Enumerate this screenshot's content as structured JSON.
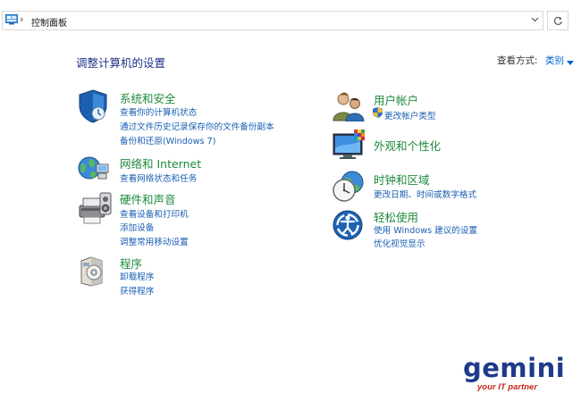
{
  "address_bar": {
    "separator": "›",
    "path": "控制面板"
  },
  "header": {
    "title": "调整计算机的设置",
    "view_by_label": "查看方式:",
    "view_by_value": "类别"
  },
  "categories": [
    {
      "title": "系统和安全",
      "icon": "system-security-icon",
      "links": [
        "查看你的计算机状态",
        "通过文件历史记录保存你的文件备份副本",
        "备份和还原(Windows 7)"
      ]
    },
    {
      "title": "网络和 Internet",
      "icon": "network-internet-icon",
      "links": [
        "查看网络状态和任务"
      ]
    },
    {
      "title": "硬件和声音",
      "icon": "hardware-sound-icon",
      "links": [
        "查看设备和打印机",
        "添加设备",
        "调整常用移动设置"
      ]
    },
    {
      "title": "程序",
      "icon": "programs-icon",
      "links": [
        "卸载程序",
        "获得程序"
      ]
    },
    {
      "title": "用户帐户",
      "icon": "user-accounts-icon",
      "links": [
        "更改帐户类型"
      ]
    },
    {
      "title": "外观和个性化",
      "icon": "appearance-personalization-icon",
      "links": []
    },
    {
      "title": "时钟和区域",
      "icon": "clock-region-icon",
      "links": [
        "更改日期、时间或数字格式"
      ]
    },
    {
      "title": "轻松使用",
      "icon": "ease-of-access-icon",
      "links": [
        "使用 Windows 建议的设置",
        "优化视觉显示"
      ]
    }
  ],
  "watermark": {
    "name": "gemini",
    "tagline": "your IT partner"
  },
  "colors": {
    "title_blue": "#1e3287",
    "category_green": "#1e8a3c",
    "link_blue": "#1a5fb4",
    "brand_navy": "#1e3a8a",
    "brand_red": "#c22a1f"
  }
}
